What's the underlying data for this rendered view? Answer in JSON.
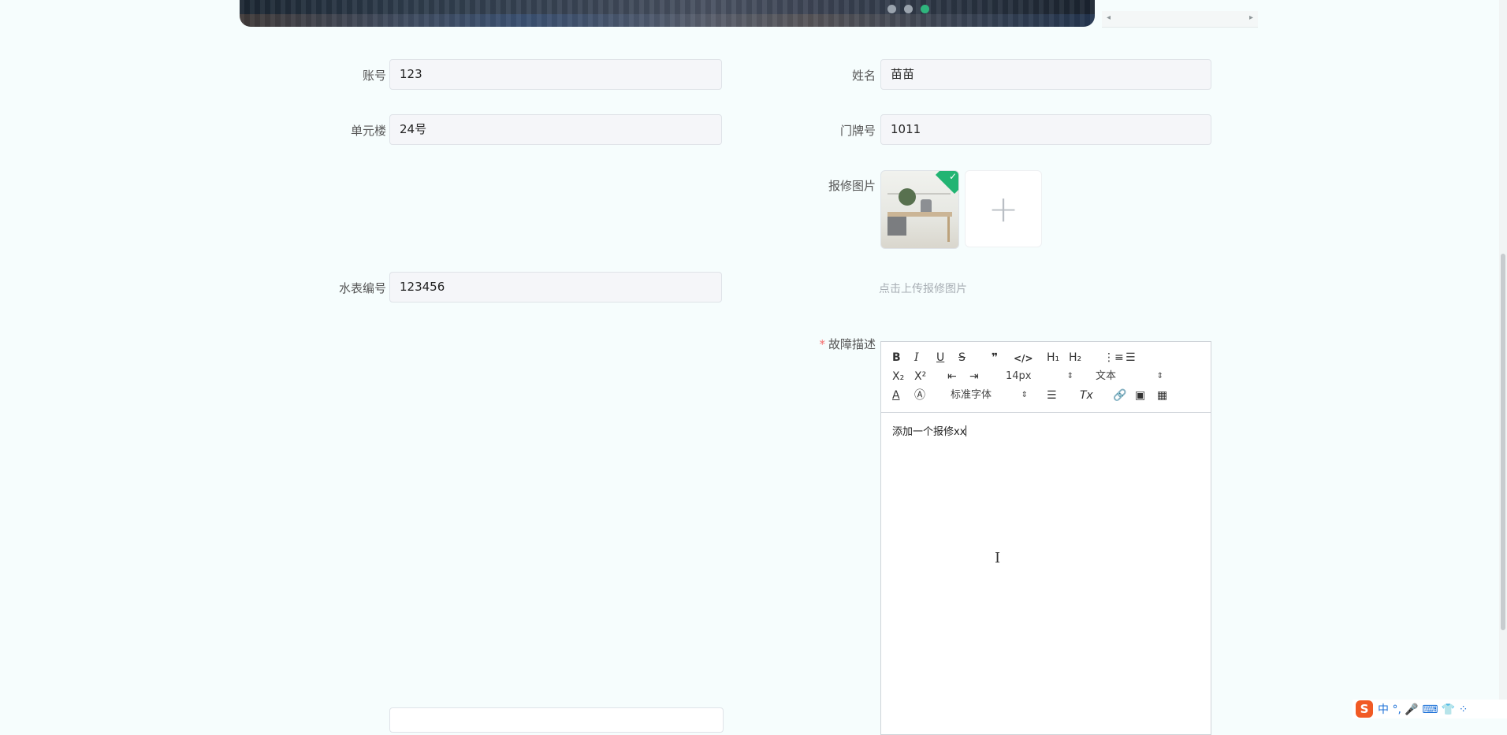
{
  "carousel": {
    "dot_count": 3,
    "active_index": 2
  },
  "side_scroll": {
    "left_arrow": "◂",
    "right_arrow": "▸"
  },
  "form": {
    "account": {
      "label": "账号",
      "value": "123"
    },
    "name": {
      "label": "姓名",
      "value": "苗苗"
    },
    "building": {
      "label": "单元楼",
      "value": "24号"
    },
    "door": {
      "label": "门牌号",
      "value": "1011"
    },
    "meter": {
      "label": "水表编号",
      "value": "123456"
    },
    "photos": {
      "label": "报修图片",
      "hint": "点击上传报修图片",
      "upload_symbol": "+"
    },
    "fault": {
      "label": "故障描述",
      "required_mark": "*"
    }
  },
  "editor": {
    "toolbar": {
      "bold": "B",
      "italic": "I",
      "underline": "U",
      "strike": "S",
      "blockquote": "❞",
      "code": "</>",
      "h1": "H₁",
      "h2": "H₂",
      "ordered_list": "⋮≡",
      "bullet_list": "☰",
      "subscript": "X₂",
      "superscript": "X²",
      "outdent": "⇤",
      "indent": "⇥",
      "size": "14px",
      "header": "文本",
      "color": "A",
      "background": "Ⓐ",
      "font": "标准字体",
      "align": "☰",
      "clean": "Tx",
      "link": "🔗",
      "image": "▣",
      "video": "▦",
      "caret": "⇕"
    },
    "content": "添加一个报修xx"
  },
  "tray": {
    "logo": "S",
    "text": "中 °, 🎤 ⌨ 👕 ⁘"
  },
  "colors": {
    "accent": "#2fb57d",
    "required": "#f56c6c",
    "background": "#f6fdfd"
  }
}
